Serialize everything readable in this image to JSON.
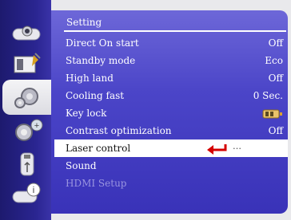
{
  "menu": {
    "title": "Setting",
    "items": [
      {
        "label": "Direct On start",
        "value": "Off"
      },
      {
        "label": "Standby mode",
        "value": "Eco"
      },
      {
        "label": "High land",
        "value": "Off"
      },
      {
        "label": "Cooling fast",
        "value": "0 Sec."
      },
      {
        "label": "Key lock",
        "value": "",
        "icon": "key-lock-icon"
      },
      {
        "label": "Contrast optimization",
        "value": "Off"
      },
      {
        "label": "Laser control",
        "value": "…",
        "icon": "return-arrow-icon"
      },
      {
        "label": "Sound",
        "value": ""
      },
      {
        "label": "HDMI Setup",
        "value": ""
      }
    ]
  },
  "sidebar": {
    "tabs": [
      {
        "icon": "display-icon"
      },
      {
        "icon": "image-adjust-icon"
      },
      {
        "icon": "setting-gear-icon"
      },
      {
        "icon": "expanded-gear-icon"
      },
      {
        "icon": "usb-drive-icon"
      },
      {
        "icon": "info-icon"
      }
    ]
  },
  "colors": {
    "panel": "#4b45c8",
    "sidebar": "#22208a",
    "highlight": "#ffffff",
    "arrow": "#d40000",
    "disabled_text": "#9a95e0"
  }
}
